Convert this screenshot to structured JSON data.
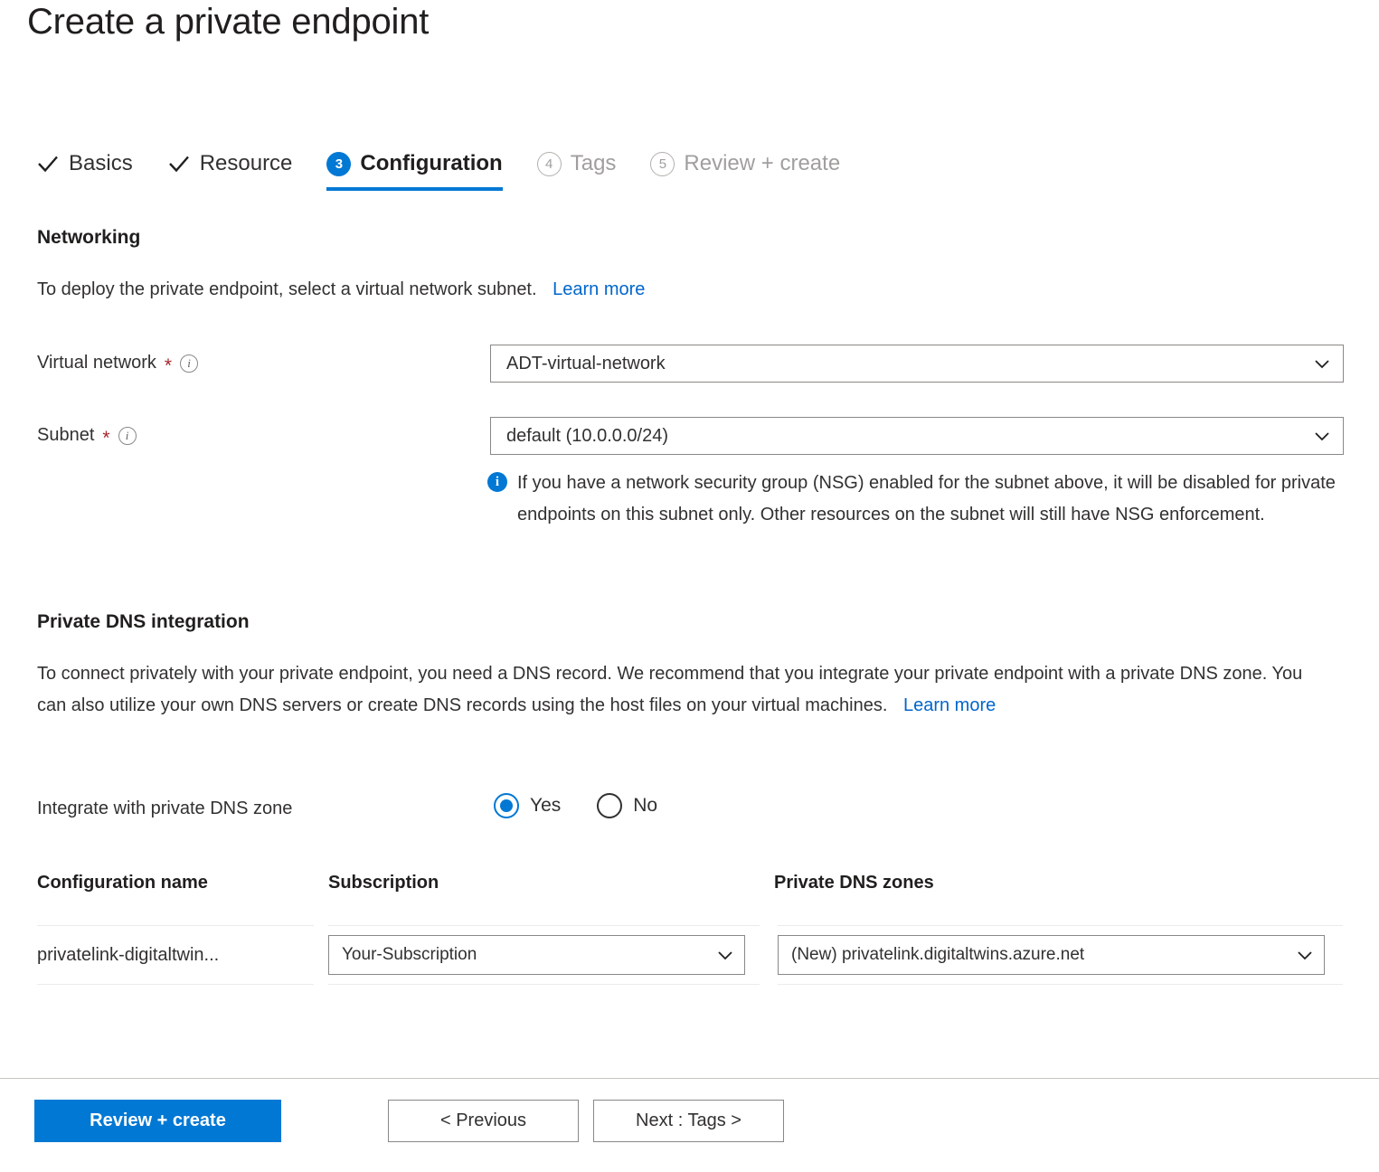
{
  "page": {
    "title": "Create a private endpoint"
  },
  "wizard": {
    "tabs": [
      {
        "label": "Basics",
        "state": "done",
        "marker": "check"
      },
      {
        "label": "Resource",
        "state": "done",
        "marker": "check"
      },
      {
        "label": "Configuration",
        "state": "active",
        "marker": "3"
      },
      {
        "label": "Tags",
        "state": "upcoming",
        "marker": "4"
      },
      {
        "label": "Review + create",
        "state": "upcoming",
        "marker": "5"
      }
    ]
  },
  "networking": {
    "heading": "Networking",
    "description": "To deploy the private endpoint, select a virtual network subnet.",
    "learn_more": "Learn more",
    "virtual_network": {
      "label": "Virtual network",
      "required_marker": "*",
      "value": "ADT-virtual-network"
    },
    "subnet": {
      "label": "Subnet",
      "required_marker": "*",
      "value": "default (10.0.0.0/24)"
    },
    "info_message": "If you have a network security group (NSG) enabled for the subnet above, it will be disabled for private endpoints on this subnet only. Other resources on the subnet will still have NSG enforcement."
  },
  "private_dns": {
    "heading": "Private DNS integration",
    "description": "To connect privately with your private endpoint, you need a DNS record. We recommend that you integrate your private endpoint with a private DNS zone. You can also utilize your own DNS servers or create DNS records using the host files on your virtual machines.",
    "learn_more": "Learn more",
    "integrate_label": "Integrate with private DNS zone",
    "options": [
      {
        "label": "Yes",
        "selected": true
      },
      {
        "label": "No",
        "selected": false
      }
    ],
    "table": {
      "headers": [
        "Configuration name",
        "Subscription",
        "Private DNS zones"
      ],
      "rows": [
        {
          "configuration_name": "privatelink-digitaltwin...",
          "subscription": "Your-Subscription",
          "private_dns_zone": "(New) privatelink.digitaltwins.azure.net"
        }
      ]
    }
  },
  "footer": {
    "review_create": "Review + create",
    "previous": "< Previous",
    "next": "Next : Tags >"
  },
  "colors": {
    "accent": "#0078d4",
    "link": "#0066cc",
    "required_star": "#a4262c",
    "text": "#323130",
    "muted": "#a19f9d"
  }
}
